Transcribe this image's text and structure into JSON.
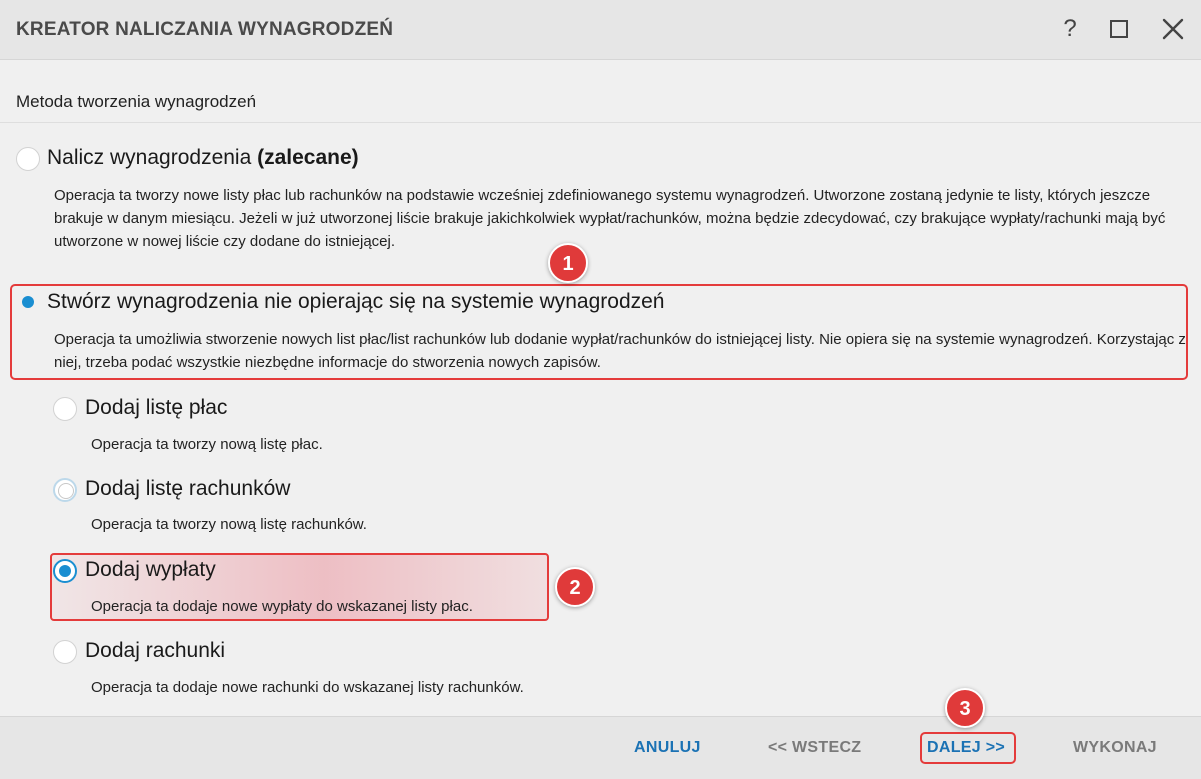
{
  "window": {
    "title": "KREATOR NALICZANIA WYNAGRODZEŃ",
    "help_glyph": "?",
    "icons": [
      "help-icon",
      "maximize-icon",
      "close-icon"
    ]
  },
  "section_label": "Metoda tworzenia wynagrodzeń",
  "options": [
    {
      "title": "Nalicz wynagrodzenia",
      "title_suffix": "(zalecane)",
      "description": "Operacja ta tworzy nowe listy płac lub rachunków na podstawie wcześniej zdefiniowanego systemu wynagrodzeń. Utworzone zostaną jedynie te listy, których jeszcze brakuje w danym miesiącu. Jeżeli w już utworzonej liście brakuje jakichkolwiek wypłat/rachunków, można będzie zdecydować, czy brakujące wypłaty/rachunki mają być utworzone w nowej liście czy dodane do istniejącej.",
      "selected": false
    },
    {
      "title": "Stwórz wynagrodzenia nie opierając się na systemie wynagrodzeń",
      "description": "Operacja ta umożliwia stworzenie nowych list płac/list rachunków lub dodanie wypłat/rachunków do istniejącej listy. Nie opiera się na systemie wynagrodzeń. Korzystając z niej, trzeba podać wszystkie niezbędne informacje do stworzenia nowych zapisów.",
      "selected": true
    }
  ],
  "sub_options": [
    {
      "title": "Dodaj listę płac",
      "description": "Operacja ta tworzy nową listę płac.",
      "selected": false
    },
    {
      "title": "Dodaj listę rachunków",
      "description": "Operacja ta tworzy nową listę rachunków.",
      "selected": false
    },
    {
      "title": "Dodaj wypłaty",
      "description": "Operacja ta dodaje nowe wypłaty do wskazanej listy płac.",
      "selected": true
    },
    {
      "title": "Dodaj rachunki",
      "description": "Operacja ta dodaje nowe rachunki do wskazanej listy rachunków.",
      "selected": false
    }
  ],
  "annotations": [
    "1",
    "2",
    "3"
  ],
  "footer": {
    "cancel": "ANULUJ",
    "back": "<< WSTECZ",
    "next": "DALEJ >>",
    "execute": "WYKONAJ"
  },
  "colors": {
    "accent": "#1a8ed1",
    "link_blue": "#1b72b4",
    "annotation_red": "#e03a3a",
    "disabled_gray": "#7a7a7a"
  }
}
